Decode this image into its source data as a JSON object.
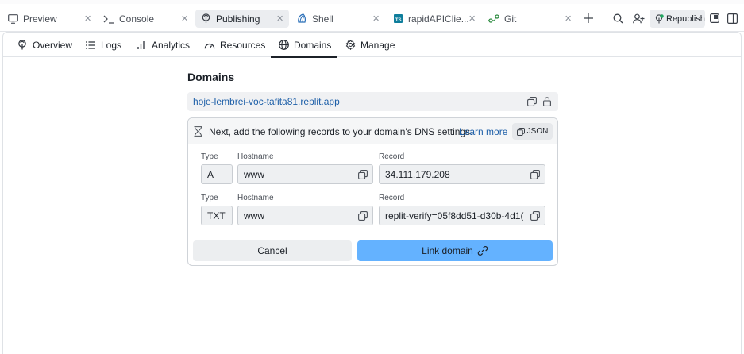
{
  "tabs": [
    {
      "label": "Preview",
      "icon": "monitor-icon",
      "active": false
    },
    {
      "label": "Console",
      "icon": "terminal-icon",
      "active": false
    },
    {
      "label": "Publishing",
      "icon": "publish-icon",
      "active": true
    },
    {
      "label": "Shell",
      "icon": "shell-icon",
      "active": false
    },
    {
      "label": "rapidAPIClie...",
      "icon": "typescript-file-icon",
      "active": false
    },
    {
      "label": "Git",
      "icon": "git-icon",
      "active": false
    }
  ],
  "toolbar": {
    "new_tab_icon": "plus-icon",
    "search_icon": "search-icon",
    "invite_icon": "add-user-icon",
    "republish_label": "Republish",
    "status_color": "#22a861",
    "accent_color": "#64b2ff"
  },
  "subnav": [
    {
      "label": "Overview",
      "icon": "publish-icon",
      "active": false
    },
    {
      "label": "Logs",
      "icon": "list-icon",
      "active": false
    },
    {
      "label": "Analytics",
      "icon": "bar-chart-icon",
      "active": false
    },
    {
      "label": "Resources",
      "icon": "gauge-icon",
      "active": false
    },
    {
      "label": "Domains",
      "icon": "globe-icon",
      "active": true
    },
    {
      "label": "Manage",
      "icon": "gear-icon",
      "active": false
    }
  ],
  "domains": {
    "title": "Domains",
    "url": "hoje-lembrei-voc-tafita81.replit.app",
    "dns": {
      "message": "Next, add the following records to your domain's DNS settings.",
      "learn_more": "Learn more",
      "json_label": "JSON",
      "labels": {
        "type": "Type",
        "hostname": "Hostname",
        "record": "Record"
      },
      "records": [
        {
          "type": "A",
          "hostname": "www",
          "record": "34.111.179.208"
        },
        {
          "type": "TXT",
          "hostname": "www",
          "record": "replit-verify=05f8dd51-d30b-4d1("
        }
      ]
    },
    "cancel_label": "Cancel",
    "link_label": "Link domain"
  }
}
